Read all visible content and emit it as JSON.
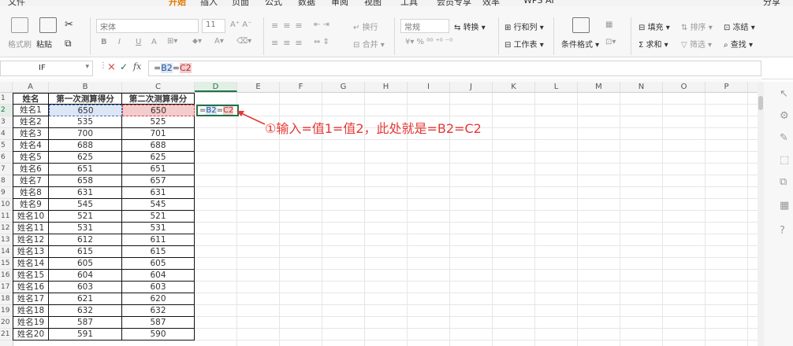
{
  "menu": {
    "items": [
      "文件",
      "开始",
      "插入",
      "页面",
      "公式",
      "数据",
      "审阅",
      "视图",
      "工具",
      "会员专享",
      "效率"
    ],
    "active_index": 1,
    "wps_ai": "WPS AI",
    "share": "分享"
  },
  "ribbon": {
    "format_painter": "格式刷",
    "paste": "粘贴",
    "font_name": "宋体",
    "font_size": "11",
    "bold": "B",
    "italic": "I",
    "underline": "U",
    "wrap": "换行",
    "merge": "合并",
    "number_format": "常规",
    "convert": "转换",
    "rows_cols": "行和列",
    "worksheet": "工作表",
    "cond_format": "条件格式",
    "fill": "填充",
    "sort": "排序",
    "freeze": "冻结",
    "sum": "求和",
    "filter": "筛选",
    "find": "查找"
  },
  "formula_bar": {
    "name_box": "IF",
    "cancel": "×",
    "confirm": "✓",
    "fx": "fx",
    "content_prefix": "=",
    "ref1": "B2",
    "op": "=",
    "ref2": "C2"
  },
  "grid": {
    "columns": [
      "A",
      "B",
      "C",
      "D",
      "E",
      "F",
      "G",
      "H",
      "I",
      "J",
      "K",
      "L",
      "M",
      "N",
      "O",
      "P"
    ],
    "active_column": "D",
    "row_numbers": [
      "1",
      "2",
      "3",
      "4",
      "5",
      "6",
      "7",
      "8",
      "9",
      "10",
      "11",
      "12",
      "13",
      "14",
      "15",
      "16",
      "17",
      "18",
      "19",
      "20",
      "21"
    ],
    "active_row": "2",
    "header": [
      "姓名",
      "第一次测算得分",
      "第二次测算得分"
    ],
    "rows": [
      [
        "姓名1",
        "650",
        "650"
      ],
      [
        "姓名2",
        "535",
        "525"
      ],
      [
        "姓名3",
        "700",
        "701"
      ],
      [
        "姓名4",
        "688",
        "688"
      ],
      [
        "姓名5",
        "625",
        "625"
      ],
      [
        "姓名6",
        "651",
        "651"
      ],
      [
        "姓名7",
        "658",
        "657"
      ],
      [
        "姓名8",
        "631",
        "631"
      ],
      [
        "姓名9",
        "545",
        "545"
      ],
      [
        "姓名10",
        "521",
        "521"
      ],
      [
        "姓名11",
        "531",
        "531"
      ],
      [
        "姓名12",
        "612",
        "611"
      ],
      [
        "姓名13",
        "615",
        "615"
      ],
      [
        "姓名14",
        "605",
        "605"
      ],
      [
        "姓名15",
        "604",
        "604"
      ],
      [
        "姓名16",
        "603",
        "603"
      ],
      [
        "姓名17",
        "621",
        "620"
      ],
      [
        "姓名18",
        "632",
        "632"
      ],
      [
        "姓名19",
        "587",
        "587"
      ],
      [
        "姓名20",
        "591",
        "590"
      ]
    ],
    "edit_cell": {
      "prefix": "=",
      "ref1": "B2",
      "op": "=",
      "ref2": "C2"
    }
  },
  "annotation": {
    "text": "①输入=值1=值2，此处就是=B2=C2",
    "color": "#e53935"
  },
  "colors": {
    "accent": "#217346",
    "ref1_border": "#4472c4",
    "ref1_fill": "#dce6f5",
    "ref2_border": "#d04545",
    "ref2_fill": "#f4cccc",
    "active_tab": "#e07b00"
  }
}
